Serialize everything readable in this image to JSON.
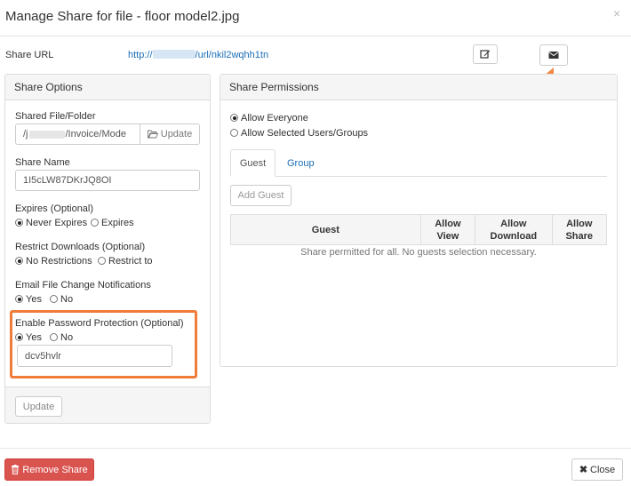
{
  "modal": {
    "title": "Manage Share for file - floor model2.jpg",
    "close_x": "×"
  },
  "share_url": {
    "label": "Share URL",
    "prefix": "http://",
    "suffix": "/url/nkil2wqhh1tn"
  },
  "share_options": {
    "heading": "Share Options",
    "shared_file_label": "Shared File/Folder",
    "shared_file_prefix": "/j",
    "shared_file_suffix": "/Invoice/Mode",
    "update_browse_label": "Update",
    "share_name_label": "Share Name",
    "share_name_value": "1I5cLW87DKrJQ8OI",
    "expires_label": "Expires (Optional)",
    "expires_opt1": "Never Expires",
    "expires_opt2": "Expires",
    "restrict_label": "Restrict Downloads (Optional)",
    "restrict_opt1": "No Restrictions",
    "restrict_opt2": "Restrict to",
    "email_label": "Email File Change Notifications",
    "email_yes": "Yes",
    "email_no": "No",
    "password_label": "Enable Password Protection (Optional)",
    "password_yes": "Yes",
    "password_no": "No",
    "password_value": "dcv5hvlr",
    "update_button": "Update"
  },
  "share_permissions": {
    "heading": "Share Permissions",
    "allow_everyone": "Allow Everyone",
    "allow_selected": "Allow Selected Users/Groups",
    "tab_guest": "Guest",
    "tab_group": "Group",
    "add_guest": "Add Guest",
    "columns": {
      "guest": "Guest",
      "allow_view_1": "Allow",
      "allow_view_2": "View",
      "allow_download_1": "Allow",
      "allow_download_2": "Download",
      "allow_share_1": "Allow",
      "allow_share_2": "Share"
    },
    "empty_message": "Share permitted for all. No guests selection necessary."
  },
  "footer": {
    "remove_share": "Remove Share",
    "close": "Close"
  },
  "colors": {
    "accent": "#1a6db5",
    "danger": "#d9534f",
    "highlight": "#f07c3a"
  }
}
